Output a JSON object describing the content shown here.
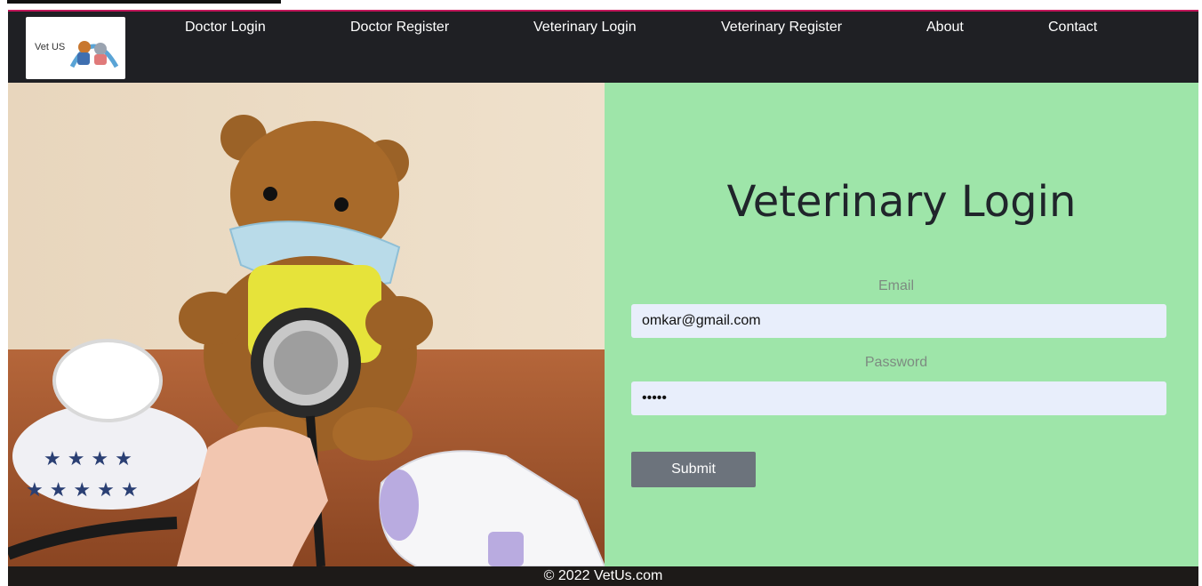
{
  "logo": {
    "text": "Vet US"
  },
  "nav": {
    "items": [
      {
        "label": "Doctor Login"
      },
      {
        "label": "Doctor Register"
      },
      {
        "label": "Veterinary Login"
      },
      {
        "label": "Veterinary Register"
      },
      {
        "label": "About"
      },
      {
        "label": "Contact"
      }
    ]
  },
  "login": {
    "title": "Veterinary Login",
    "email_label": "Email",
    "email_value": "omkar@gmail.com",
    "password_label": "Password",
    "password_value": "•••••",
    "submit_label": "Submit"
  },
  "footer": {
    "text": "© 2022 VetUs.com"
  },
  "colors": {
    "navbar_bg": "#1f2024",
    "panel_bg": "#9ee5a9",
    "input_bg": "#e8eefb",
    "button_bg": "#6c737c"
  }
}
